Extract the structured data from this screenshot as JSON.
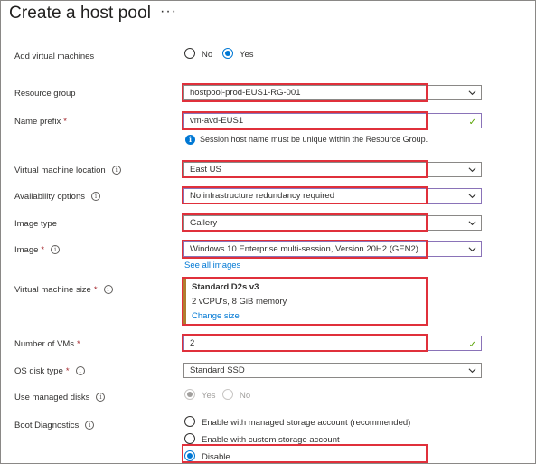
{
  "header": {
    "title": "Create a host pool",
    "more_label": "···"
  },
  "form": {
    "add_vms": {
      "label": "Add virtual machines",
      "options": [
        "No",
        "Yes"
      ],
      "selected": "Yes"
    },
    "resource_group": {
      "label": "Resource group",
      "value": "hostpool-prod-EUS1-RG-001"
    },
    "name_prefix": {
      "label": "Name prefix",
      "value": "vm-avd-EUS1",
      "note": "Session host name must be unique within the Resource Group."
    },
    "vm_location": {
      "label": "Virtual machine location",
      "value": "East US"
    },
    "availability": {
      "label": "Availability options",
      "value": "No infrastructure redundancy required"
    },
    "image_type": {
      "label": "Image type",
      "value": "Gallery"
    },
    "image": {
      "label": "Image",
      "value": "Windows 10 Enterprise multi-session, Version 20H2 (GEN2)",
      "see_all": "See all images"
    },
    "vm_size": {
      "label": "Virtual machine size",
      "title": "Standard D2s v3",
      "spec": "2 vCPU's, 8 GiB memory",
      "change": "Change size"
    },
    "num_vms": {
      "label": "Number of VMs",
      "value": "2"
    },
    "os_disk": {
      "label": "OS disk type",
      "value": "Standard SSD"
    },
    "managed_disks": {
      "label": "Use managed disks",
      "options": [
        "Yes",
        "No"
      ],
      "selected": "Yes"
    },
    "boot_diag": {
      "label": "Boot Diagnostics",
      "options": [
        "Enable with managed storage account (recommended)",
        "Enable with custom storage account",
        "Disable"
      ],
      "selected": "Disable"
    }
  },
  "colors": {
    "accent": "#0078d4",
    "highlight": "#e0303b",
    "valid": "#57a300",
    "required": "#a4262c"
  }
}
